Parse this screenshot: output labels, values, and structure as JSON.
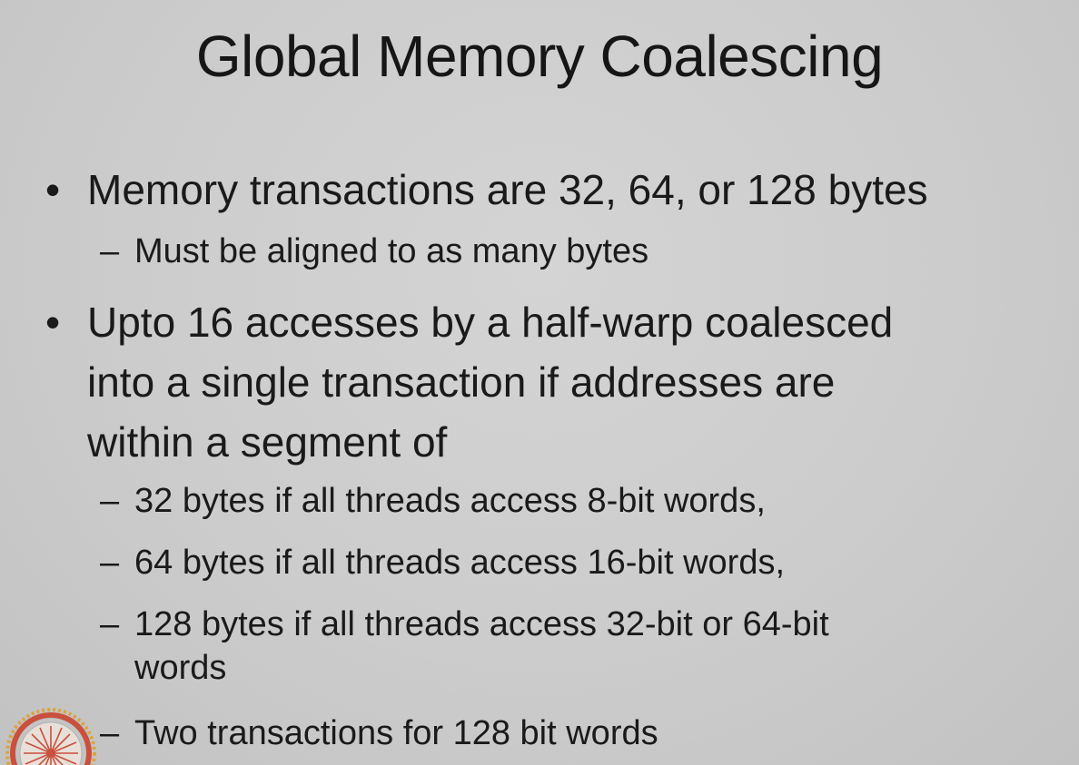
{
  "slide": {
    "title": "Global Memory Coalescing",
    "bullet_symbol": "•",
    "sub_symbol": "–",
    "bullets": [
      {
        "text": "Memory transactions are 32, 64, or 128 bytes",
        "subs": [
          "Must be aligned to as many bytes"
        ]
      },
      {
        "lines": [
          "Upto 16 accesses by a half-warp coalesced",
          "into a single transaction if addresses are",
          "within a segment of"
        ],
        "subs": [
          "32 bytes if all threads access 8-bit words,",
          "64 bytes if all threads access 16-bit words,",
          "128 bytes if all threads access 32-bit or 64-bit",
          "words",
          "Two transactions for 128 bit words"
        ]
      }
    ]
  },
  "colors": {
    "background": "#cdcdcd",
    "text": "#1a1a1a",
    "logo_ring": "#c9503d",
    "logo_gold": "#d9a441"
  },
  "icons": {
    "logo": "institute-emblem-icon"
  }
}
